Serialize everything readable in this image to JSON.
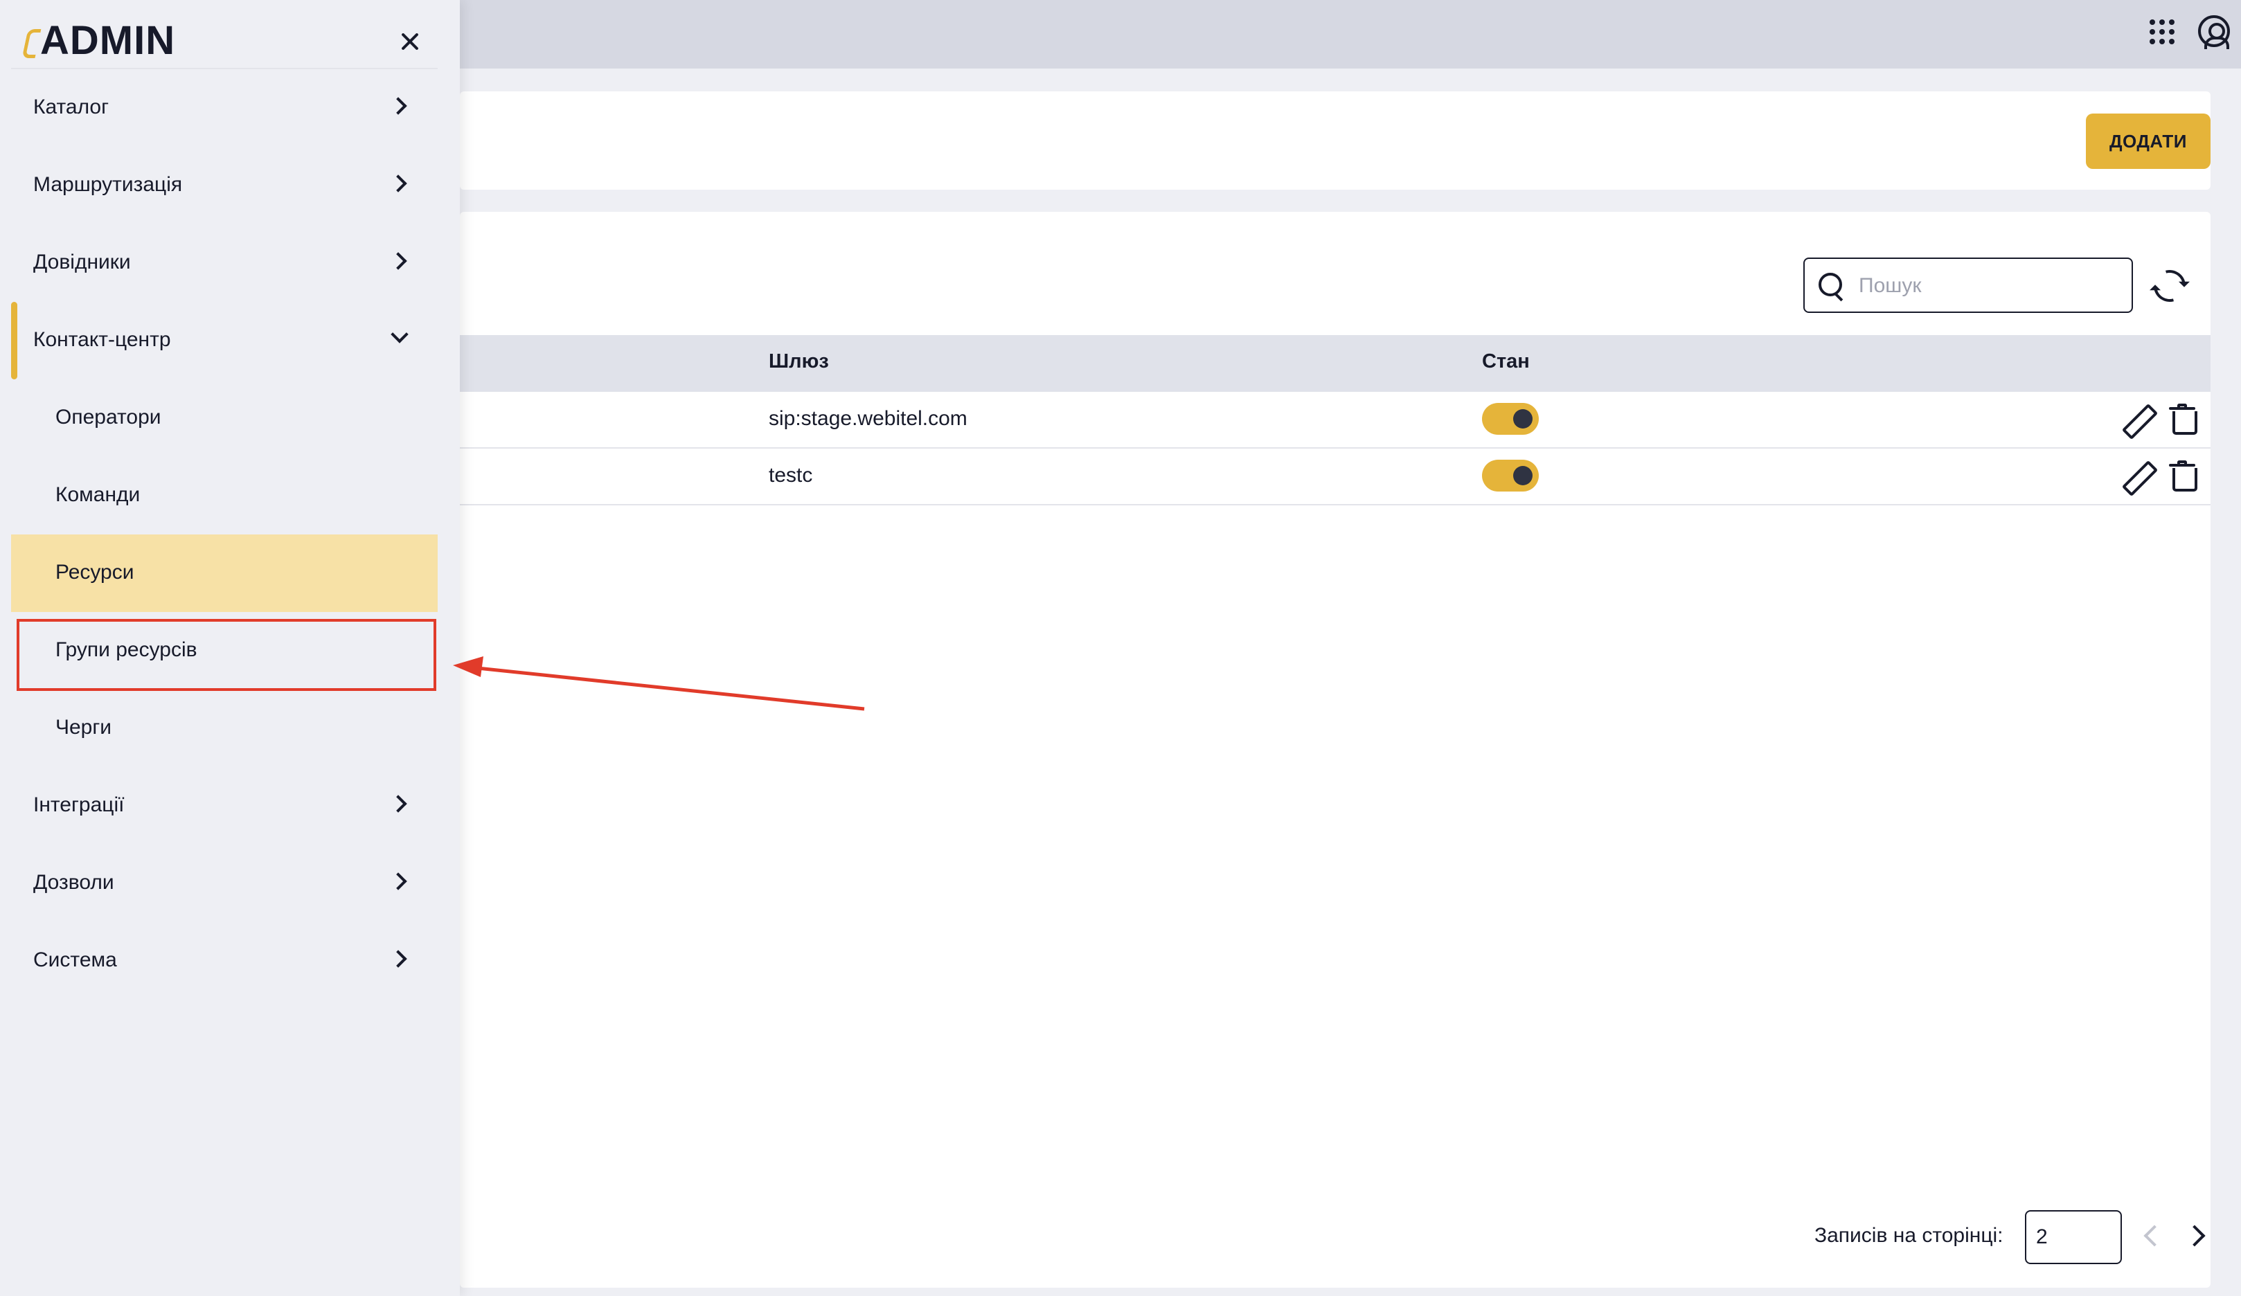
{
  "sidebar": {
    "logo_text": "ADMIN",
    "items": [
      {
        "label": "Каталог"
      },
      {
        "label": "Маршрутизація"
      },
      {
        "label": "Довідники"
      },
      {
        "label": "Контакт-центр"
      },
      {
        "label": "Інтеграції"
      },
      {
        "label": "Дозволи"
      },
      {
        "label": "Система"
      }
    ],
    "contact_center_sub": [
      {
        "label": "Оператори"
      },
      {
        "label": "Команди"
      },
      {
        "label": "Ресурси"
      },
      {
        "label": "Групи ресурсів"
      },
      {
        "label": "Черги"
      }
    ]
  },
  "header": {
    "add_label": "ДОДАТИ"
  },
  "search": {
    "placeholder": "Пошук"
  },
  "table": {
    "columns": [
      "Шлюз",
      "Стан"
    ],
    "rows": [
      {
        "gateway": "sip:stage.webitel.com",
        "enabled": true
      },
      {
        "gateway": "testc",
        "enabled": true
      }
    ]
  },
  "pagination": {
    "per_page_label": "Записів на сторінці:",
    "per_page_value": "2"
  },
  "colors": {
    "accent": "#e5b43a",
    "active_item_bg": "#f7e1a6",
    "annotation": "#e13b2a"
  }
}
